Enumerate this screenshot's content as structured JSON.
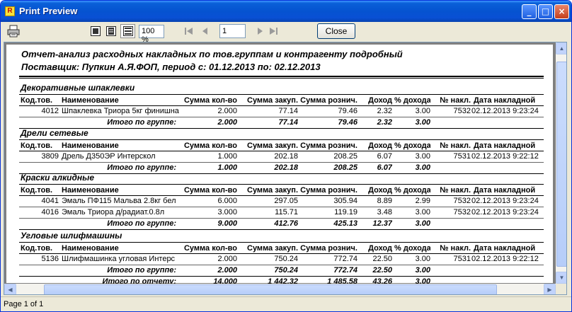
{
  "window": {
    "title": "Print Preview",
    "app_icon_letter": "R",
    "controls": {
      "minimize": "_",
      "maximize": "□",
      "close": "×"
    }
  },
  "toolbar": {
    "zoom": "100 %",
    "page_number": "1",
    "close_label": "Close"
  },
  "report": {
    "title_line1": "Отчет-анализ расходных накладных по тов.группам и контрагенту подробный",
    "title_line2": "Поставщик: Пупкин А.Я.ФОП, период с: 01.12.2013 по: 02.12.2013",
    "columns": [
      "Код.тов.",
      "Наименование",
      "Сумма кол-во",
      "Сумма закуп.",
      "Сумма рознич.",
      "Доход",
      "% дохода",
      "№ накл.",
      "Дата накладной"
    ],
    "groups": [
      {
        "name": "Декоративные шпаклевки",
        "rows": [
          {
            "code": "4012",
            "name": "Шпаклевка Триора 5кг финишна",
            "qty": "2.000",
            "purch": "77.14",
            "retail": "79.46",
            "income": "2.32",
            "pct": "3.00",
            "doc": "7532",
            "date": "02.12.2013 9:23:24"
          }
        ],
        "total": {
          "label": "Итого по группе:",
          "qty": "2.000",
          "purch": "77.14",
          "retail": "79.46",
          "income": "2.32",
          "pct": "3.00"
        }
      },
      {
        "name": "Дрели сетевые",
        "rows": [
          {
            "code": "3809",
            "name": "Дрель Д350ЭР Интерскол",
            "qty": "1.000",
            "purch": "202.18",
            "retail": "208.25",
            "income": "6.07",
            "pct": "3.00",
            "doc": "7531",
            "date": "02.12.2013 9:22:12"
          }
        ],
        "total": {
          "label": "Итого по группе:",
          "qty": "1.000",
          "purch": "202.18",
          "retail": "208.25",
          "income": "6.07",
          "pct": "3.00"
        }
      },
      {
        "name": "Краски алкидные",
        "rows": [
          {
            "code": "4041",
            "name": "Эмаль ПФ115 Мальва 2.8кг бел",
            "qty": "6.000",
            "purch": "297.05",
            "retail": "305.94",
            "income": "8.89",
            "pct": "2.99",
            "doc": "7532",
            "date": "02.12.2013 9:23:24"
          },
          {
            "code": "4016",
            "name": "Эмаль Триора д/радиат.0.8л",
            "qty": "3.000",
            "purch": "115.71",
            "retail": "119.19",
            "income": "3.48",
            "pct": "3.00",
            "doc": "7532",
            "date": "02.12.2013 9:23:24"
          }
        ],
        "total": {
          "label": "Итого по группе:",
          "qty": "9.000",
          "purch": "412.76",
          "retail": "425.13",
          "income": "12.37",
          "pct": "3.00"
        }
      },
      {
        "name": "Угловые шлифмашины",
        "rows": [
          {
            "code": "5136",
            "name": "Шлифмашинка угловая Интерс",
            "qty": "2.000",
            "purch": "750.24",
            "retail": "772.74",
            "income": "22.50",
            "pct": "3.00",
            "doc": "7531",
            "date": "02.12.2013 9:22:12"
          }
        ],
        "total": {
          "label": "Итого по группе:",
          "qty": "2.000",
          "purch": "750.24",
          "retail": "772.74",
          "income": "22.50",
          "pct": "3.00"
        }
      }
    ],
    "grand_total": {
      "label": "Итого по отчету:",
      "qty": "14.000",
      "purch": "1 442.32",
      "retail": "1 485.58",
      "income": "43.26",
      "pct": "3.00"
    }
  },
  "status": {
    "page_info": "Page 1 of 1"
  },
  "colors": {
    "title_bar": "#0553d0",
    "window_bg": "#ece9d8",
    "viewport_bg": "#808080"
  }
}
